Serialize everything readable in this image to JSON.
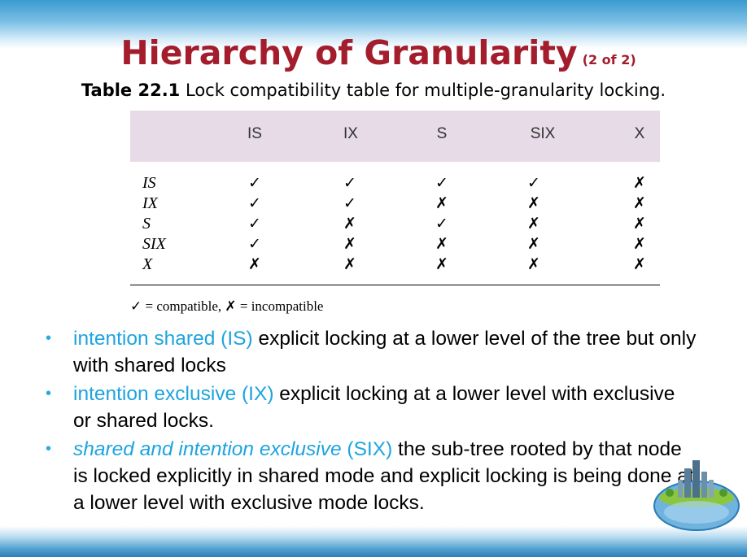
{
  "title": "Hierarchy of Granularity",
  "title_suffix": "(2 of 2)",
  "caption": {
    "label": "Table 22.1",
    "text": "Lock compatibility table for multiple-granularity locking."
  },
  "table": {
    "columns": [
      "IS",
      "IX",
      "S",
      "SIX",
      "X"
    ],
    "rows": [
      {
        "label": "IS",
        "cells": [
          "✓",
          "✓",
          "✓",
          "✓",
          "✗"
        ]
      },
      {
        "label": "IX",
        "cells": [
          "✓",
          "✓",
          "✗",
          "✗",
          "✗"
        ]
      },
      {
        "label": "S",
        "cells": [
          "✓",
          "✗",
          "✓",
          "✗",
          "✗"
        ]
      },
      {
        "label": "SIX",
        "cells": [
          "✓",
          "✗",
          "✗",
          "✗",
          "✗"
        ]
      },
      {
        "label": "X",
        "cells": [
          "✗",
          "✗",
          "✗",
          "✗",
          "✗"
        ]
      }
    ]
  },
  "legend": {
    "check": "✓",
    "check_text": "= compatible,",
    "cross": "✗",
    "cross_text": "= incompatible"
  },
  "bullets": [
    {
      "term": "intention shared (IS)",
      "term_style": "normal",
      "abbr": "",
      "text": "explicit locking at a lower level of the tree but only with shared locks"
    },
    {
      "term": "intention exclusive (IX)",
      "term_style": "normal",
      "abbr": "",
      "text": "explicit locking at a lower level with exclusive or shared locks."
    },
    {
      "term": "shared and intention exclusive",
      "term_style": "italic",
      "abbr": "(SIX)",
      "text": "the sub-tree rooted by that node is locked explicitly in shared mode and explicit locking is being done at a lower level with exclusive mode locks."
    }
  ],
  "colors": {
    "title": "#a31d2c",
    "accent": "#1da4df",
    "table_header_bg": "#e6dbe6"
  },
  "icons": [
    "bullet-dot-icon",
    "globe-city-icon"
  ]
}
